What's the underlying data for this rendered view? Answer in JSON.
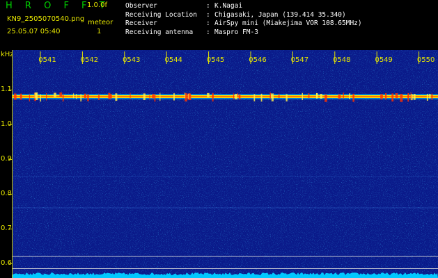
{
  "header": {
    "title": "H R O F F T",
    "version": "1.0.0f",
    "filename": "KN9_2505070540.png",
    "meteor_label": "meteor",
    "datetime": "25.05.07 05:40",
    "meteor_count": "1"
  },
  "info": [
    {
      "key": "Observer",
      "sep": ":",
      "value": "K.Nagai"
    },
    {
      "key": "Receiving Location",
      "sep": ":",
      "value": "Chigasaki, Japan (139.414 35.340)"
    },
    {
      "key": "Receiver",
      "sep": ":",
      "value": "AirSpy mini (Miakejima VOR 108.65MHz)"
    },
    {
      "key": "Receiving antenna",
      "sep": ":",
      "value": "Maspro FM-3"
    }
  ],
  "spectrogram": {
    "y_unit": "kHz",
    "y_ticks": [
      "1.1",
      "1.0",
      "0.9",
      "0.8",
      "0.7",
      "0.6"
    ],
    "time_labels": [
      "0541",
      "0542",
      "0543",
      "0544",
      "0545",
      "0546",
      "0547",
      "0548",
      "0549",
      "0550"
    ],
    "carrier_khz": 1.08
  },
  "colors": {
    "background": "#0a1a8a",
    "label": "#e8e800",
    "title": "#00d000",
    "carrier": "#ff7800",
    "noise_floor": "#00c8ff"
  }
}
